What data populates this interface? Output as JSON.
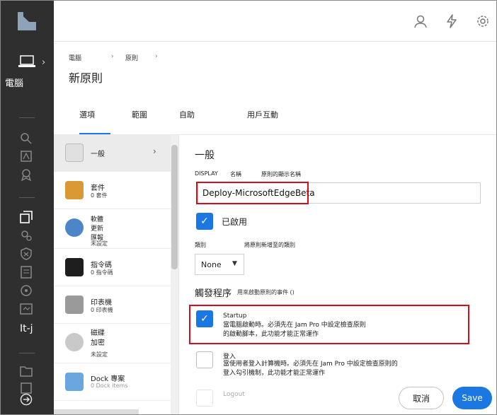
{
  "header": {
    "breadcrumbs": [
      "電腦",
      "原則"
    ],
    "crumb_sep": "›",
    "title": "新原則"
  },
  "topbar": {
    "icons": [
      "user-icon",
      "bolt-icon",
      "gear-icon"
    ]
  },
  "rail": {
    "section_label": "電腦",
    "chevron": "›",
    "bottom_label": "It-j",
    "icons": [
      "laptop-icon",
      "search-icon",
      "inventory-icon",
      "smart-group-icon",
      "policies-icon",
      "settings-icon",
      "security-icon",
      "reports-icon",
      "share-icon",
      "enrollment-icon",
      "folder-icon",
      "collapse-icon"
    ]
  },
  "tabs": [
    "選項",
    "範圍",
    "自助",
    "用戶互動"
  ],
  "categories": [
    {
      "name": "一般",
      "sub": "",
      "icon": "general-icon",
      "selected": true
    },
    {
      "name": "套件",
      "sub": "0 套件",
      "icon": "package-icon"
    },
    {
      "name": "軟體\n更新\n匯報",
      "sub": "未設定",
      "icon": "software-update-icon"
    },
    {
      "name": "指令碼",
      "sub": "0 指令碼",
      "icon": "script-icon"
    },
    {
      "name": "印表機",
      "sub": "0 印表機",
      "icon": "printer-icon"
    },
    {
      "name": "磁碟\n加密",
      "sub": "未設定",
      "icon": "disk-encryption-icon"
    },
    {
      "name": "Dock 專案",
      "sub": "0 Dock items",
      "icon": "dock-icon"
    }
  ],
  "general": {
    "section_title": "一般",
    "display_label": "DISPLAY",
    "name_label": "名稱",
    "name_hint": "原則的顯示名稱",
    "name_value": "Deploy-MicrosoftEdgeBeta",
    "enabled_label": "已啟用",
    "category_label": "類別",
    "category_hint": "將原則新增至的類別",
    "category_value": "None",
    "trigger_title": "觸發程序",
    "trigger_hint": "用來啟動原則的事件 ()",
    "triggers": [
      {
        "name": "Startup",
        "desc": "當電腦啟動時。必須先在 Jam Pro 中設定檢查原則的啟動腳本，此功能才能正常運作",
        "checked": true
      },
      {
        "name": "登入",
        "desc": "當使用者登入計算機時。必須先在 Jam Pro 中設定檢查原則的登入勾引機制，此功能才能正常運作",
        "checked": false
      },
      {
        "name": "Logout",
        "desc": "",
        "checked": false
      }
    ]
  },
  "footer": {
    "cancel": "取消",
    "save": "Save"
  },
  "colors": {
    "accent": "#1b78e2",
    "highlight": "#d40e1e",
    "rail": "#2f2f2f"
  }
}
